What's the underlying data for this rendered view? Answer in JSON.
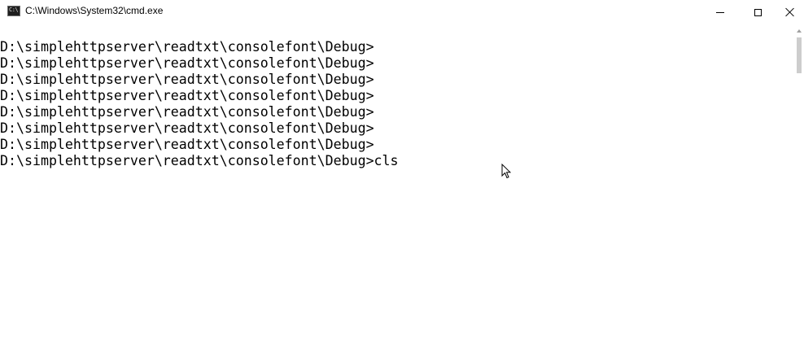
{
  "window": {
    "title": "C:\\Windows\\System32\\cmd.exe",
    "icon_label": "C:\\"
  },
  "console": {
    "lines": [
      "D:\\simplehttpserver\\readtxt\\consolefont\\Debug>",
      "D:\\simplehttpserver\\readtxt\\consolefont\\Debug>",
      "D:\\simplehttpserver\\readtxt\\consolefont\\Debug>",
      "D:\\simplehttpserver\\readtxt\\consolefont\\Debug>",
      "D:\\simplehttpserver\\readtxt\\consolefont\\Debug>",
      "D:\\simplehttpserver\\readtxt\\consolefont\\Debug>",
      "D:\\simplehttpserver\\readtxt\\consolefont\\Debug>",
      "D:\\simplehttpserver\\readtxt\\consolefont\\Debug>cls"
    ]
  },
  "icons": {
    "app": "console-app-icon",
    "minimize": "minimize-icon",
    "maximize": "maximize-icon",
    "close": "close-icon",
    "cursor": "mouse-pointer-icon",
    "scroll_up": "scroll-up-arrow-icon"
  },
  "colors": {
    "background": "#ffffff",
    "text": "#000000"
  }
}
